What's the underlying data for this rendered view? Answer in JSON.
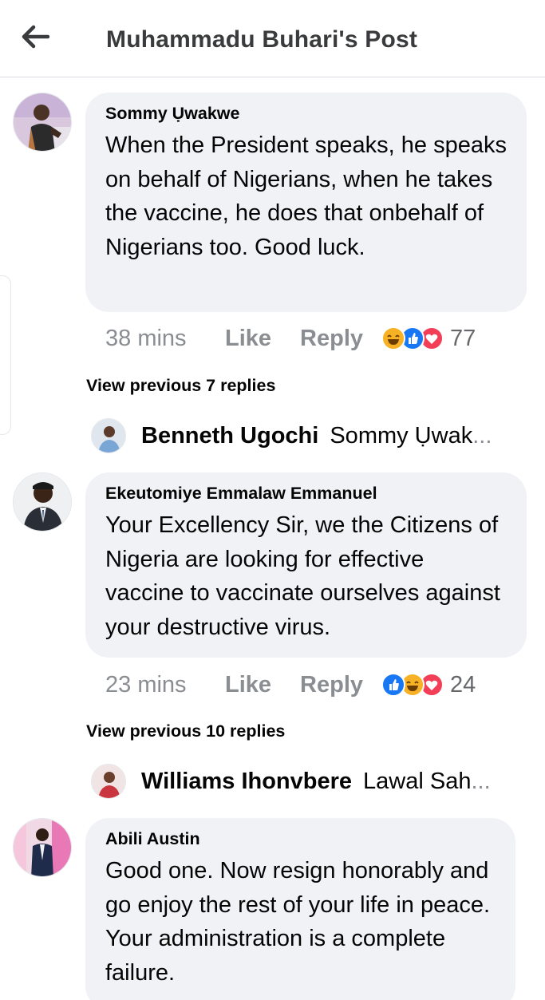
{
  "header": {
    "title": "Muhammadu Buhari's Post",
    "back_icon": "arrow-left-icon"
  },
  "comments": [
    {
      "author": "Sommy Ụwakwe",
      "text": "When the President speaks, he speaks on behalf of Nigerians, when he takes the vaccine, he does that onbehalf of Nigerians too. Good luck.",
      "time": "38 mins",
      "like_label": "Like",
      "reply_label": "Reply",
      "reactions": [
        "haha",
        "like",
        "love"
      ],
      "reaction_count": "77",
      "view_previous": "View previous 7 replies",
      "latest_reply": {
        "author": "Benneth Ugochi",
        "snippet": "Sommy Ụwak",
        "ellipsis": "..."
      }
    },
    {
      "author": "Ekeutomiye Emmalaw Emmanuel",
      "text": "Your Excellency Sir, we the Citizens of Nigeria are looking for effective vaccine to vaccinate ourselves against your destructive virus.",
      "time": "23 mins",
      "like_label": "Like",
      "reply_label": "Reply",
      "reactions": [
        "like",
        "haha",
        "love"
      ],
      "reaction_count": "24",
      "view_previous": "View previous 10 replies",
      "latest_reply": {
        "author": "Williams Ihonvbere",
        "snippet": "Lawal Sah",
        "ellipsis": "..."
      }
    },
    {
      "author": "Abili Austin",
      "text": "Good one. Now resign honorably and go enjoy the rest of your life in peace. Your administration is a complete failure."
    }
  ],
  "colors": {
    "like": "#1877f2",
    "love": "#f33e58",
    "haha": "#f7b125",
    "bubble": "#f0f2f5"
  }
}
